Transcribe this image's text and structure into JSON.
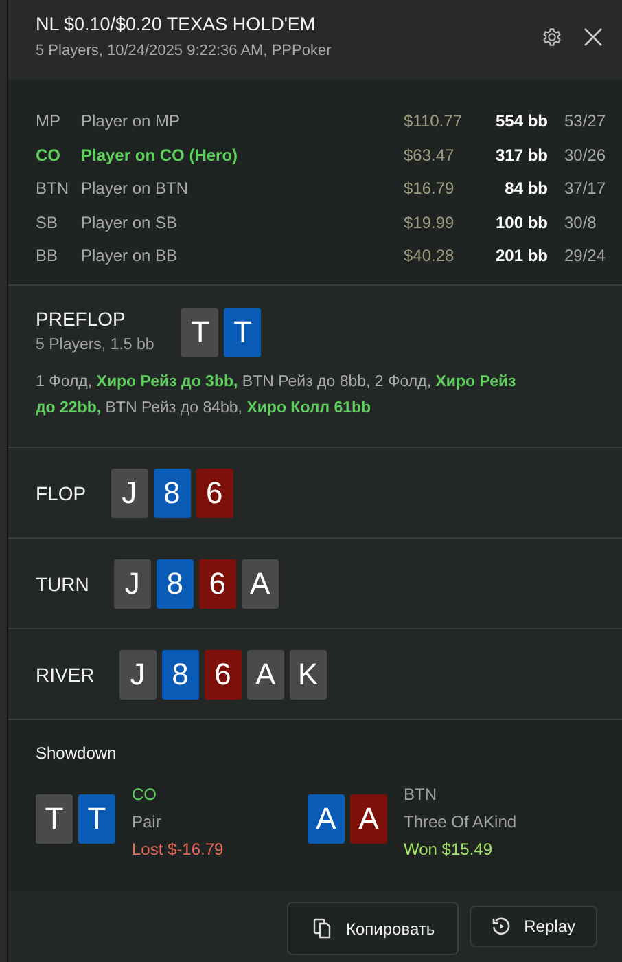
{
  "header": {
    "title": "NL $0.10/$0.20 TEXAS HOLD'EM",
    "subtitle": "5 Players, 10/24/2025 9:22:36 AM, PPPoker"
  },
  "players": [
    {
      "position": "MP",
      "name": "Player on MP",
      "stack": "$110.77",
      "bb": "554 bb",
      "stats": "53/27",
      "hero": false
    },
    {
      "position": "CO",
      "name": "Player on CO (Hero)",
      "stack": "$63.47",
      "bb": "317 bb",
      "stats": "30/26",
      "hero": true
    },
    {
      "position": "BTN",
      "name": "Player on BTN",
      "stack": "$16.79",
      "bb": "84 bb",
      "stats": "37/17",
      "hero": false
    },
    {
      "position": "SB",
      "name": "Player on SB",
      "stack": "$19.99",
      "bb": "100 bb",
      "stats": "30/8",
      "hero": false
    },
    {
      "position": "BB",
      "name": "Player on BB",
      "stack": "$40.28",
      "bb": "201 bb",
      "stats": "29/24",
      "hero": false
    }
  ],
  "streets": [
    {
      "name": "PREFLOP",
      "info": "5 Players, 1.5 bb",
      "actions": "1 Фолд, **Хиро Рейз до 3bb,** BTN Рейз до 8bb, 2 Фолд, **Хиро Рейз до 22bb,** BTN Рейз до 84bb, **Хиро Колл 61bb**",
      "cards": [
        {
          "rank": "T",
          "color": "#4a4a4a"
        },
        {
          "rank": "T",
          "color": "#0a5bb5"
        }
      ]
    },
    {
      "name": "FLOP",
      "cards": [
        {
          "rank": "J",
          "color": "#4a4a4a"
        },
        {
          "rank": "8",
          "color": "#0a5bb5"
        },
        {
          "rank": "6",
          "color": "#7d1008"
        }
      ]
    },
    {
      "name": "TURN",
      "cards": [
        {
          "rank": "J",
          "color": "#4a4a4a"
        },
        {
          "rank": "8",
          "color": "#0a5bb5"
        },
        {
          "rank": "6",
          "color": "#7d1008"
        },
        {
          "rank": "A",
          "color": "#4a4a4a"
        }
      ]
    },
    {
      "name": "RIVER",
      "cards": [
        {
          "rank": "J",
          "color": "#4a4a4a"
        },
        {
          "rank": "8",
          "color": "#0a5bb5"
        },
        {
          "rank": "6",
          "color": "#7d1008"
        },
        {
          "rank": "A",
          "color": "#4a4a4a"
        },
        {
          "rank": "K",
          "color": "#4a4a4a"
        }
      ]
    }
  ],
  "showdown": {
    "title": "Showdown",
    "hands": [
      {
        "position": "CO",
        "hero": true,
        "hand": "Pair",
        "result": "Lost $-16.79",
        "kind": "lost",
        "cards": [
          {
            "rank": "T",
            "color": "#4a4a4a"
          },
          {
            "rank": "T",
            "color": "#0a5bb5"
          }
        ]
      },
      {
        "position": "BTN",
        "hero": false,
        "hand": "Three Of AKind",
        "result": "Won $15.49",
        "kind": "won",
        "cards": [
          {
            "rank": "A",
            "color": "#0a5bb5"
          },
          {
            "rank": "A",
            "color": "#7d1008"
          }
        ]
      }
    ]
  },
  "buttons": [
    {
      "label": "Копировать",
      "kind": "copy"
    },
    {
      "label": "Replay",
      "kind": "replay"
    }
  ]
}
